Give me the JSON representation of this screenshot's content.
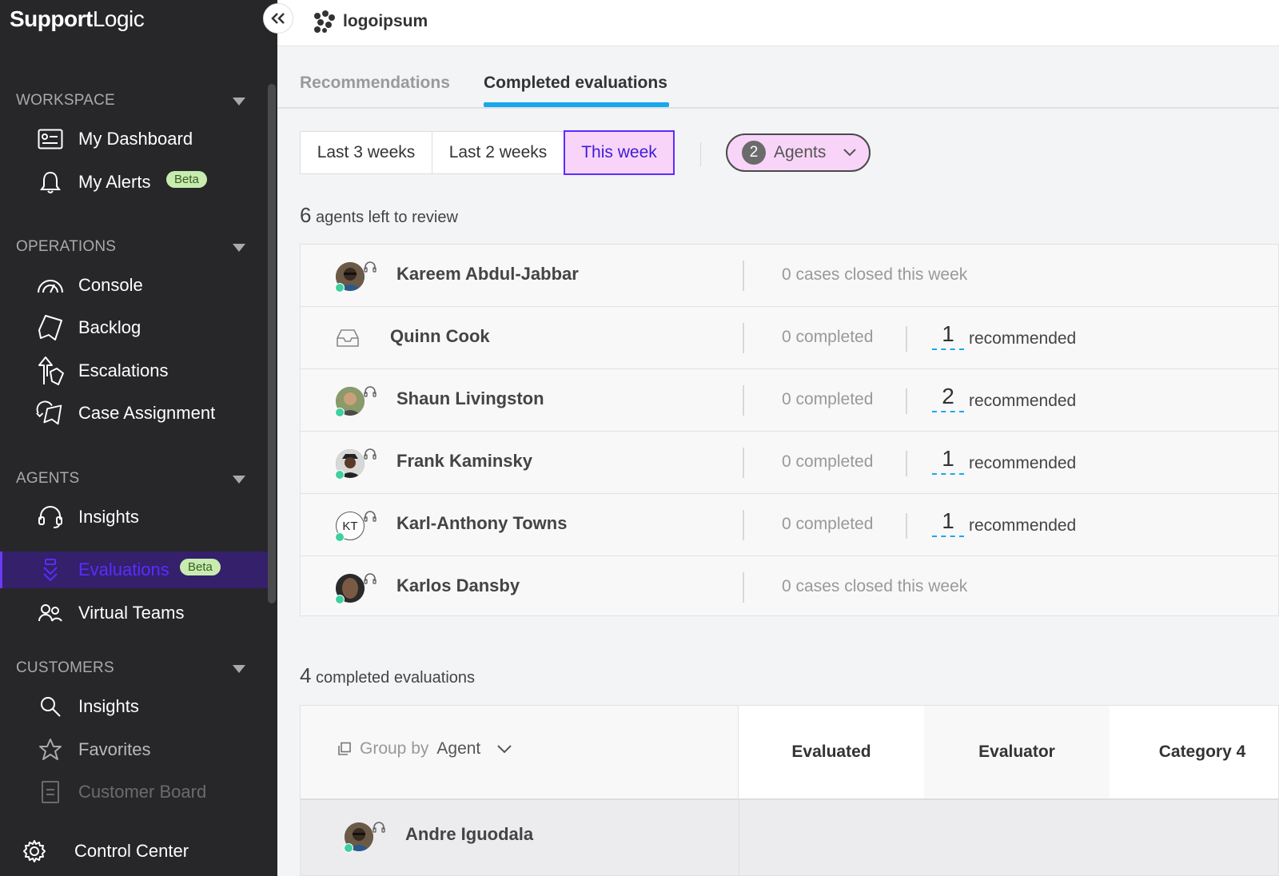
{
  "brand": {
    "bold": "Support",
    "light": "Logic"
  },
  "sidebar": {
    "sections": [
      {
        "title": "WORKSPACE",
        "items": [
          {
            "label": "My Dashboard",
            "icon": "dashboard-card-icon"
          },
          {
            "label": "My Alerts",
            "icon": "bell-icon",
            "badge": "Beta"
          }
        ]
      },
      {
        "title": "OPERATIONS",
        "items": [
          {
            "label": "Console",
            "icon": "gauge-icon"
          },
          {
            "label": "Backlog",
            "icon": "backlog-icon"
          },
          {
            "label": "Escalations",
            "icon": "escalation-arrow-icon"
          },
          {
            "label": "Case Assignment",
            "icon": "case-assignment-icon"
          }
        ]
      },
      {
        "title": "AGENTS",
        "items": [
          {
            "label": "Insights",
            "icon": "headset-icon"
          },
          {
            "label": "Evaluations",
            "icon": "evaluation-icon",
            "badge": "Beta",
            "active": true
          },
          {
            "label": "Virtual Teams",
            "icon": "team-icon"
          }
        ]
      },
      {
        "title": "CUSTOMERS",
        "items": [
          {
            "label": "Insights",
            "icon": "search-icon"
          },
          {
            "label": "Favorites",
            "icon": "star-icon"
          },
          {
            "label": "Customer Board",
            "icon": "board-icon"
          }
        ]
      }
    ],
    "control_center": "Control Center"
  },
  "header": {
    "logo_text": "logoipsum"
  },
  "tabs": [
    {
      "label": "Recommendations",
      "active": false
    },
    {
      "label": "Completed evaluations",
      "active": true
    }
  ],
  "filters": {
    "periods": [
      "Last 3 weeks",
      "Last 2 weeks",
      "This week"
    ],
    "selected_period": "This week",
    "agents_count": "2",
    "agents_label": "Agents"
  },
  "review": {
    "count": "6",
    "label": "agents left to review"
  },
  "agents": [
    {
      "name": "Kareem Abdul-Jabbar",
      "avatar": "photo",
      "stat": "0 cases closed this week"
    },
    {
      "name": "Quinn Cook",
      "avatar": "inbox",
      "stat": "0 completed",
      "recommended": "1",
      "rec_label": "recommended"
    },
    {
      "name": "Shaun Livingston",
      "avatar": "photo",
      "stat": "0 completed",
      "recommended": "2",
      "rec_label": "recommended"
    },
    {
      "name": "Frank Kaminsky",
      "avatar": "photo",
      "stat": "0 completed",
      "recommended": "1",
      "rec_label": "recommended"
    },
    {
      "name": "Karl-Anthony Towns",
      "avatar": "initials",
      "initials": "KT",
      "stat": "0 completed",
      "recommended": "1",
      "rec_label": "recommended"
    },
    {
      "name": "Karlos Dansby",
      "avatar": "photo",
      "stat": "0 cases closed this week"
    }
  ],
  "completed": {
    "count": "4",
    "label": "completed evaluations",
    "group_by_prefix": "Group by",
    "group_by_value": "Agent",
    "columns": [
      "Evaluated",
      "Evaluator",
      "Category 4"
    ],
    "rows": [
      {
        "name": "Andre Iguodala"
      }
    ]
  }
}
